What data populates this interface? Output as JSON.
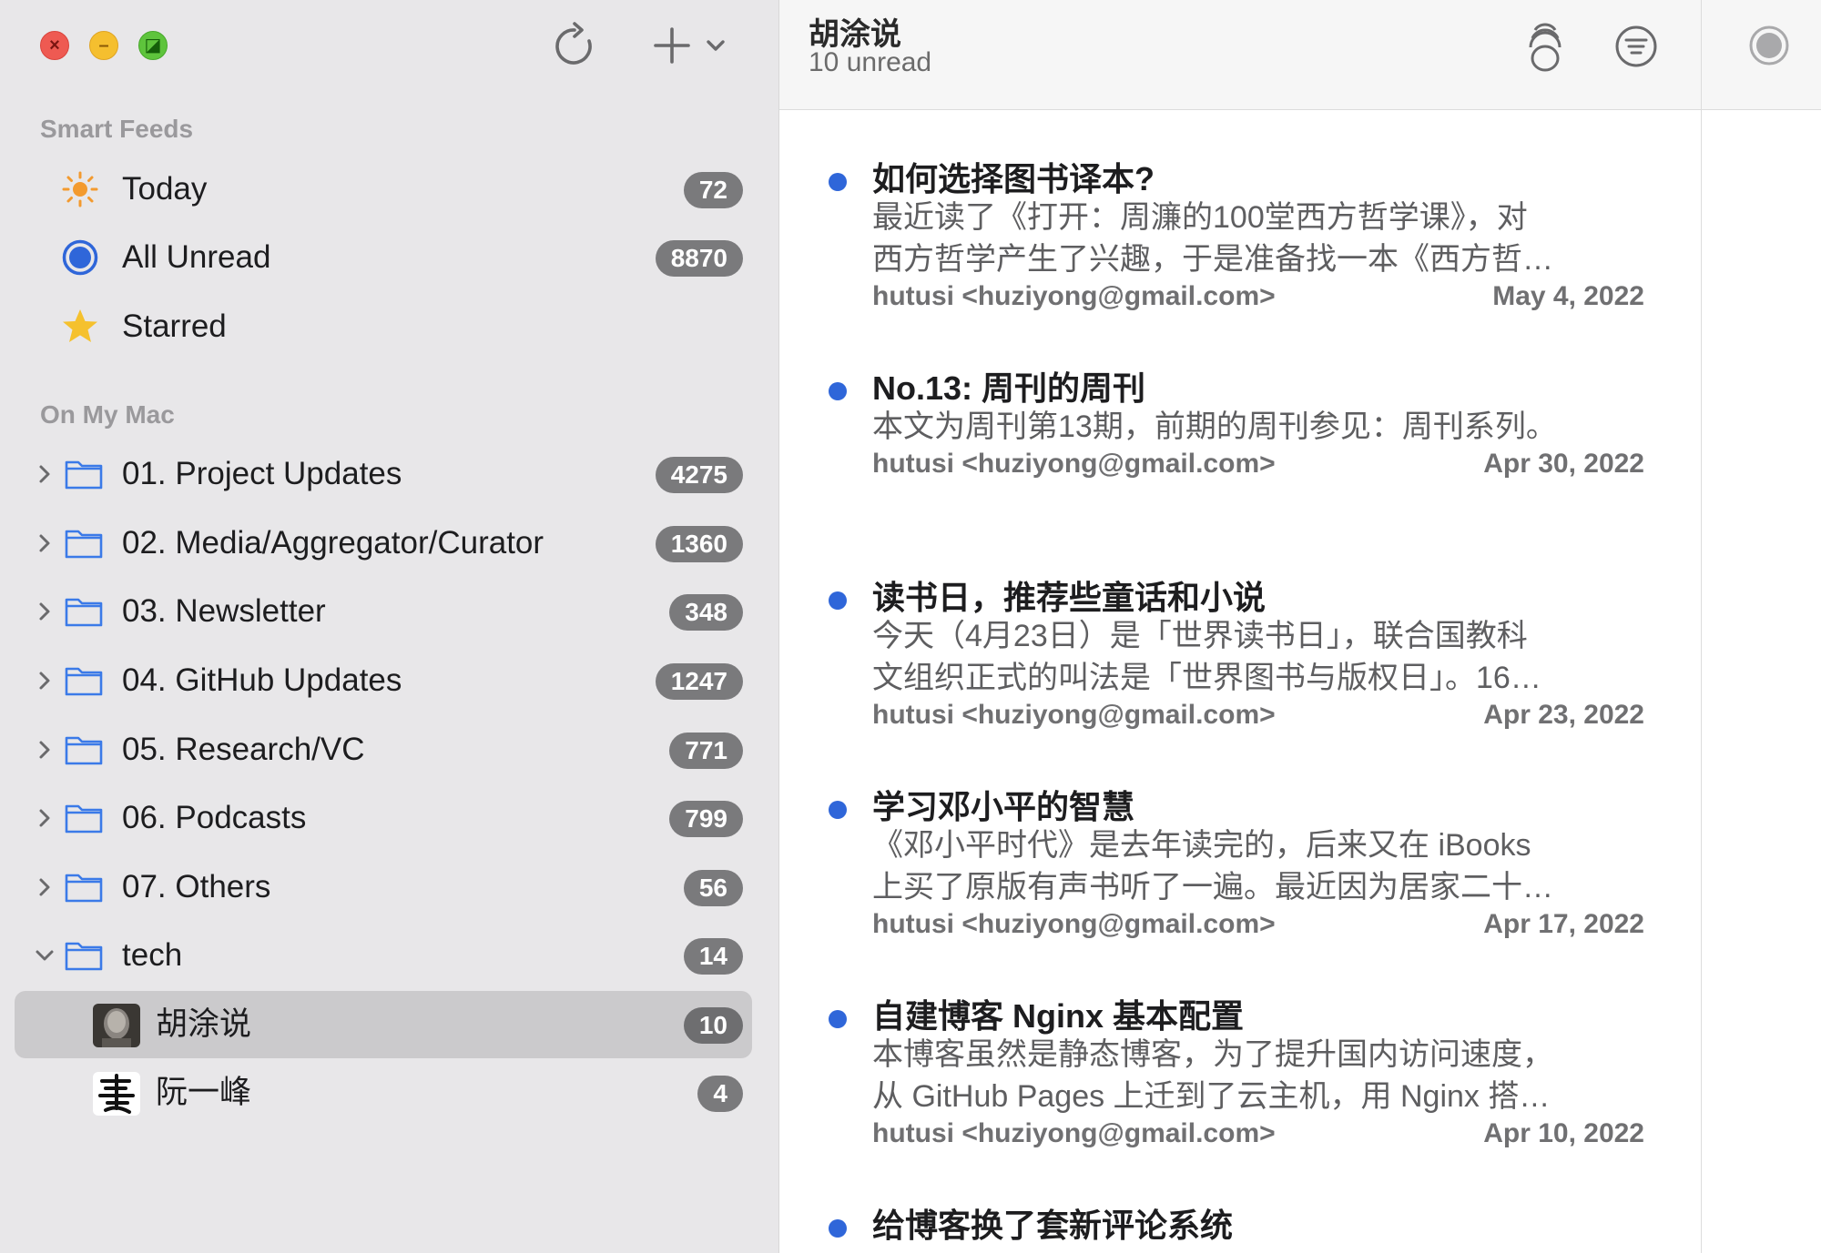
{
  "sidebar": {
    "window_buttons": {
      "close": "×",
      "minimize": "–",
      "zoom": "◪"
    },
    "toolbar": {
      "refresh_icon": "refresh-icon",
      "add_icon": "plus-icon"
    },
    "smart_feeds_title": "Smart Feeds",
    "smart_feeds": [
      {
        "label": "Today",
        "count": "72",
        "icon": "sun-icon"
      },
      {
        "label": "All Unread",
        "count": "8870",
        "icon": "unread-circle-icon"
      },
      {
        "label": "Starred",
        "count": "",
        "icon": "star-icon"
      }
    ],
    "on_my_mac_title": "On My Mac",
    "folders": [
      {
        "label": "01. Project Updates",
        "count": "4275"
      },
      {
        "label": "02. Media/Aggregator/Curator",
        "count": "1360"
      },
      {
        "label": "03. Newsletter",
        "count": "348"
      },
      {
        "label": "04. GitHub Updates",
        "count": "1247"
      },
      {
        "label": "05. Research/VC",
        "count": "771"
      },
      {
        "label": "06. Podcasts",
        "count": "799"
      },
      {
        "label": "07. Others",
        "count": "56"
      },
      {
        "label": "tech",
        "count": "14"
      }
    ],
    "feeds": [
      {
        "label": "胡涂说",
        "count": "10"
      },
      {
        "label": "阮一峰",
        "count": "4"
      }
    ]
  },
  "list": {
    "feed_title": "胡涂说",
    "unread_text": "10 unread",
    "articles": [
      {
        "title": "如何选择图书译本?",
        "summary_line1": "最近读了《打开：周濂的100堂西方哲学课》，对",
        "summary_line2": "西方哲学产生了兴趣，于是准备找一本《西方哲…",
        "author": "hutusi <huziyong@gmail.com>",
        "date": "May 4, 2022"
      },
      {
        "title": "No.13: 周刊的周刊",
        "summary_line1": "本文为周刊第13期，前期的周刊参见：周刊系列。",
        "summary_line2": "",
        "author": "hutusi <huziyong@gmail.com>",
        "date": "Apr 30, 2022"
      },
      {
        "title": "读书日，推荐些童话和小说",
        "summary_line1": "今天（4月23日）是「世界读书日」，联合国教科",
        "summary_line2": "文组织正式的叫法是「世界图书与版权日」。16…",
        "author": "hutusi <huziyong@gmail.com>",
        "date": "Apr 23, 2022"
      },
      {
        "title": "学习邓小平的智慧",
        "summary_line1": "《邓小平时代》是去年读完的，后来又在 iBooks",
        "summary_line2": "上买了原版有声书听了一遍。最近因为居家二十…",
        "author": "hutusi <huziyong@gmail.com>",
        "date": "Apr 17, 2022"
      },
      {
        "title": "自建博客 Nginx 基本配置",
        "summary_line1": "本博客虽然是静态博客，为了提升国内访问速度，",
        "summary_line2": "从 GitHub Pages 上迁到了云主机，用 Nginx 搭…",
        "author": "hutusi <huziyong@gmail.com>",
        "date": "Apr 10, 2022"
      },
      {
        "title": "给博客换了套新评论系统",
        "summary_line1": "",
        "summary_line2": "",
        "author": "",
        "date": ""
      }
    ]
  },
  "colors": {
    "sidebar_bg": "#e8e7e9",
    "badge_bg": "#7a7a7c",
    "unread_dot": "#2f66d9",
    "folder_icon": "#3b7ae8"
  }
}
